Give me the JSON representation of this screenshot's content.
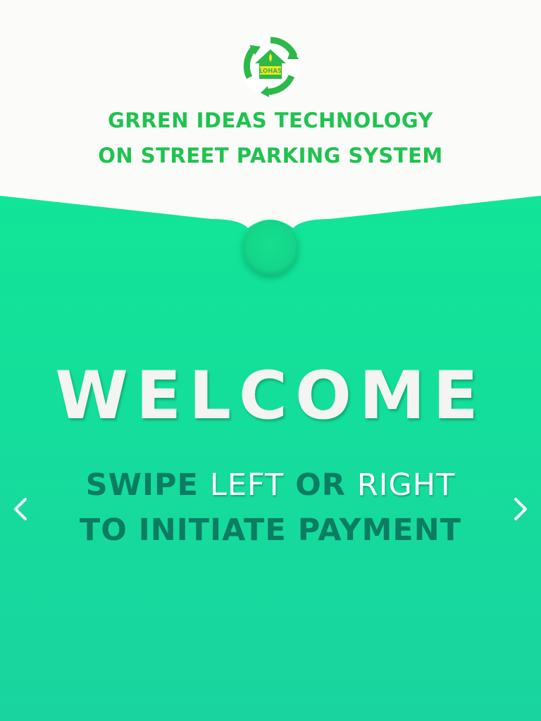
{
  "header": {
    "logo_text": "LOHAS",
    "title_line1": "GRREN IDEAS TECHNOLOGY",
    "title_line2": "ON STREET PARKING SYSTEM"
  },
  "main": {
    "welcome": "WELCOME",
    "swipe_word": "SWIPE",
    "left_word": "LEFT",
    "or_word": "OR",
    "right_word": "RIGHT",
    "line2": "TO INITIATE PAYMENT"
  },
  "nav": {
    "left_icon": "chevron-left-icon",
    "right_icon": "chevron-right-icon"
  },
  "colors": {
    "brand_green": "#1fc34f",
    "panel_green_top": "#13e497",
    "panel_green_bottom": "#18d59f",
    "dark_teal_text": "#0b7d62",
    "welcome_text": "#f4f4f2"
  }
}
